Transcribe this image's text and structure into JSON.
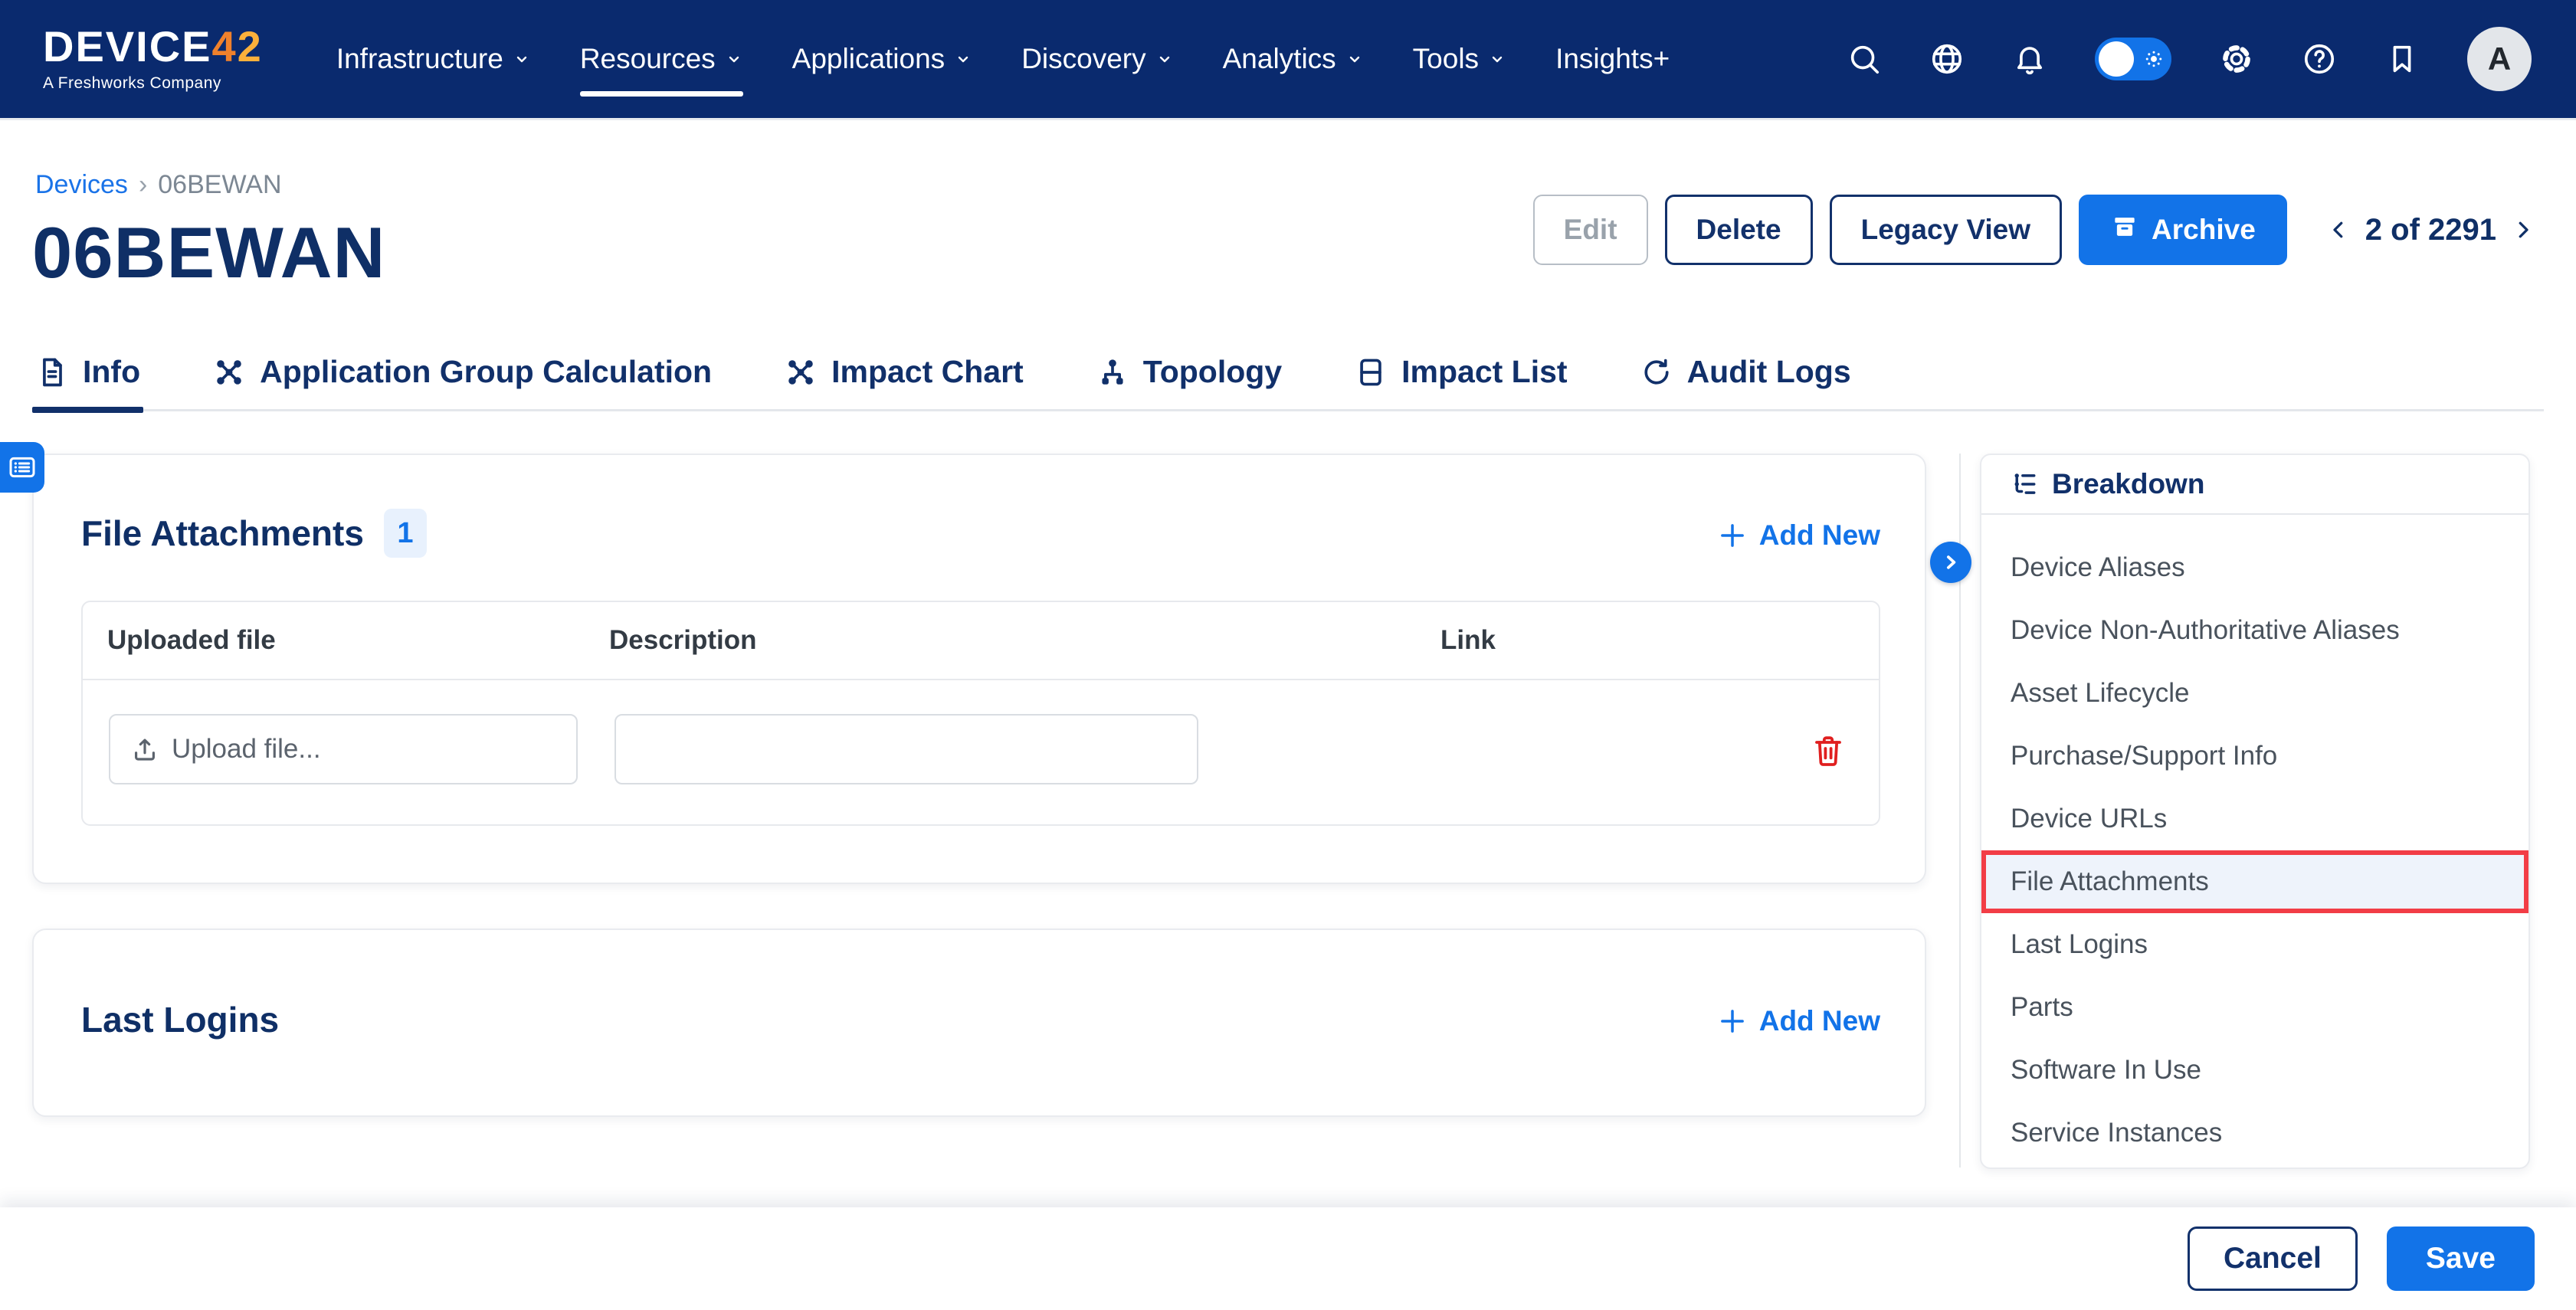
{
  "navbar": {
    "logo": {
      "text": "DEVIC",
      "e": "E",
      "accent1": "4",
      "accent2": "2",
      "tagline": "A Freshworks Company"
    },
    "menu": [
      {
        "label": "Infrastructure"
      },
      {
        "label": "Resources"
      },
      {
        "label": "Applications"
      },
      {
        "label": "Discovery"
      },
      {
        "label": "Analytics"
      },
      {
        "label": "Tools"
      },
      {
        "label": "Insights+"
      }
    ],
    "active_item": "Resources",
    "icons": [
      "search",
      "globe",
      "notifications",
      "theme-toggle",
      "settings",
      "help",
      "bookmark",
      "account"
    ],
    "avatar_initial": "A"
  },
  "header": {
    "breadcrumb": {
      "parent": "Devices",
      "separator": "›",
      "current": "06BEWAN"
    },
    "title": "06BEWAN",
    "actions": {
      "edit": "Edit",
      "delete": "Delete",
      "legacy_view": "Legacy View",
      "archive": "Archive"
    },
    "pagination": {
      "label": "2 of 2291"
    }
  },
  "tabs": [
    {
      "label": "Info",
      "active": true
    },
    {
      "label": "Application Group Calculation",
      "active": false
    },
    {
      "label": "Impact Chart",
      "active": false
    },
    {
      "label": "Topology",
      "active": false
    },
    {
      "label": "Impact List",
      "active": false
    },
    {
      "label": "Audit Logs",
      "active": false
    }
  ],
  "file_attachments": {
    "title": "File Attachments",
    "count": "1",
    "add_new": "Add New",
    "columns": {
      "uploaded_file": "Uploaded file",
      "description": "Description",
      "link": "Link"
    },
    "row": {
      "upload_label": "Upload file...",
      "description_value": ""
    }
  },
  "last_logins": {
    "title": "Last Logins",
    "add_new": "Add New"
  },
  "breakdown": {
    "title": "Breakdown",
    "items": [
      {
        "label": "Device Aliases",
        "highlighted": false
      },
      {
        "label": "Device Non-Authoritative Aliases",
        "highlighted": false
      },
      {
        "label": "Asset Lifecycle",
        "highlighted": false
      },
      {
        "label": "Purchase/Support Info",
        "highlighted": false
      },
      {
        "label": "Device URLs",
        "highlighted": false
      },
      {
        "label": "File Attachments",
        "highlighted": true
      },
      {
        "label": "Last Logins",
        "highlighted": false
      },
      {
        "label": "Parts",
        "highlighted": false
      },
      {
        "label": "Software In Use",
        "highlighted": false
      },
      {
        "label": "Service Instances",
        "highlighted": false
      }
    ]
  },
  "footer": {
    "cancel": "Cancel",
    "save": "Save"
  },
  "colors": {
    "navbar_bg": "#0a2a6e",
    "accent_blue": "#1273e8",
    "navy_text": "#11306a",
    "danger_red": "#e01f1f",
    "highlight_border": "#f23d46",
    "highlight_bg": "#eef3fb",
    "badge_bg": "#e8f1fd"
  }
}
